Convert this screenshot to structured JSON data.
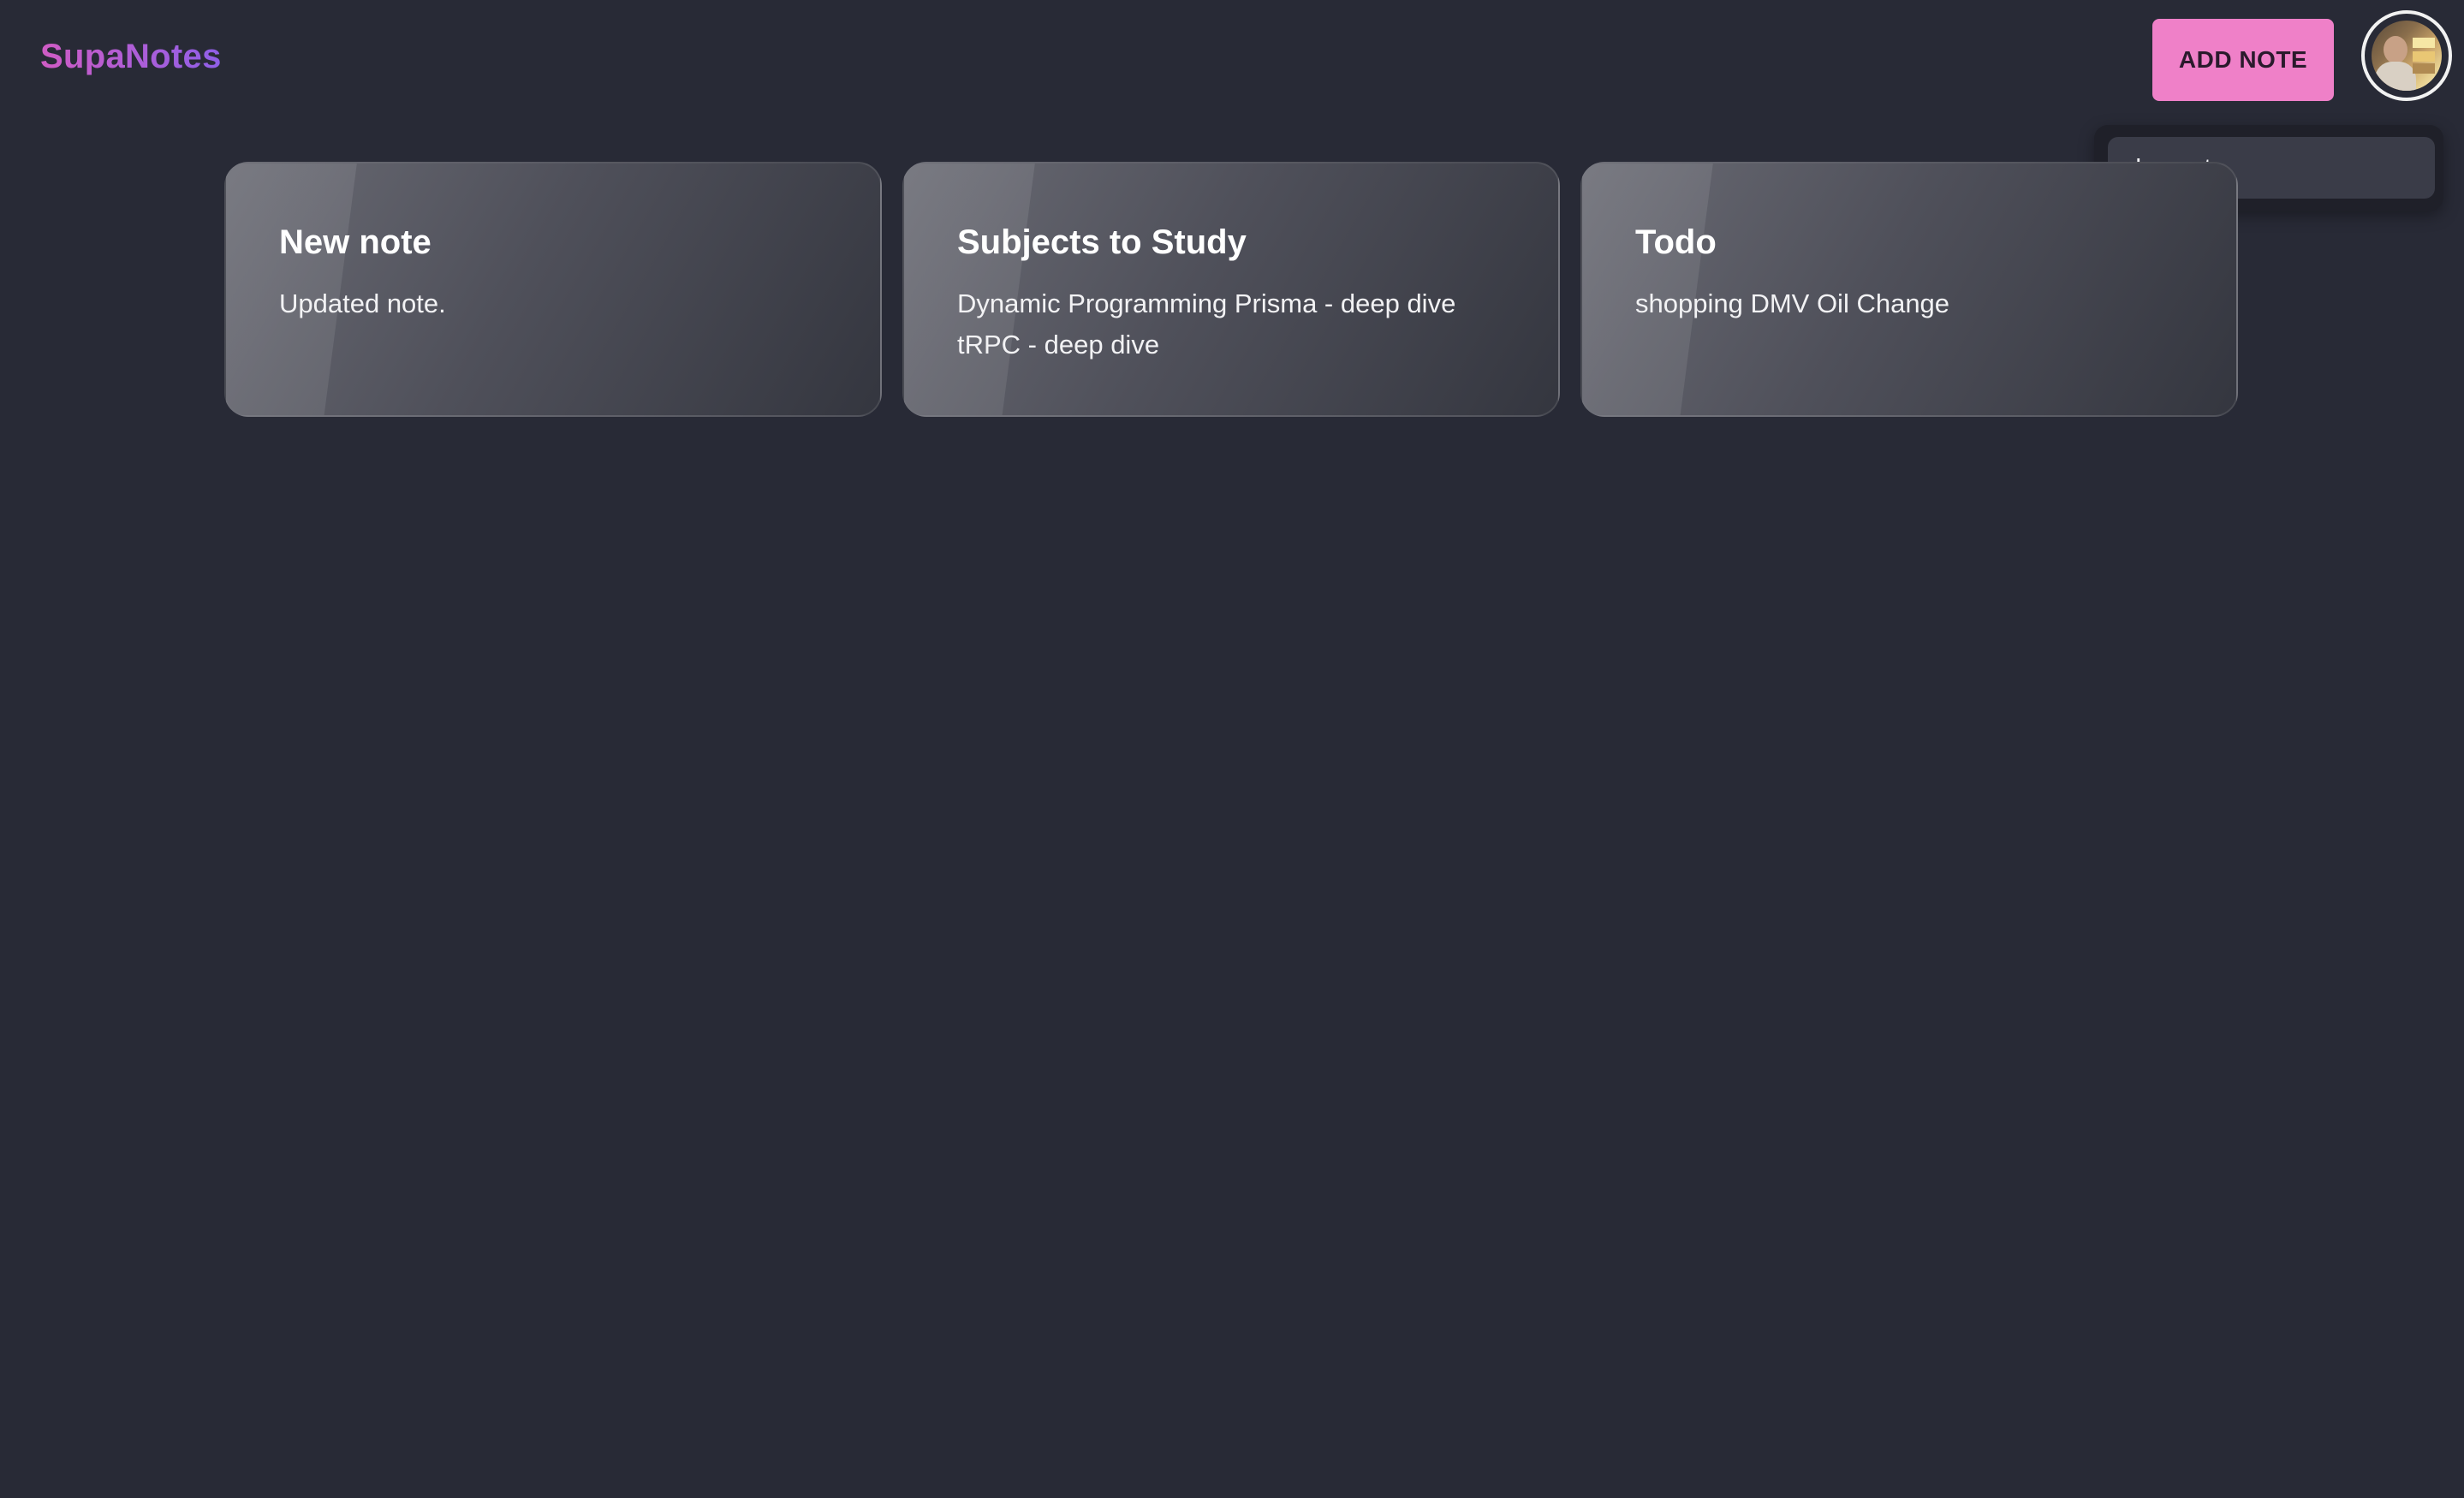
{
  "brand": "SupaNotes",
  "header": {
    "add_note_label": "ADD NOTE"
  },
  "user_menu": {
    "items": [
      {
        "label": "Logout"
      }
    ]
  },
  "notes": [
    {
      "title": "New note",
      "body": "Updated note."
    },
    {
      "title": "Subjects to Study",
      "body": "Dynamic Programming Prisma - deep dive\ntRPC - deep dive"
    },
    {
      "title": "Todo",
      "body": "shopping DMV Oil Change"
    }
  ],
  "colors": {
    "background": "#282a36",
    "accent_button": "#ef80c8",
    "brand_gradient_start": "#d05cc4",
    "brand_gradient_end": "#8f5fe8"
  }
}
